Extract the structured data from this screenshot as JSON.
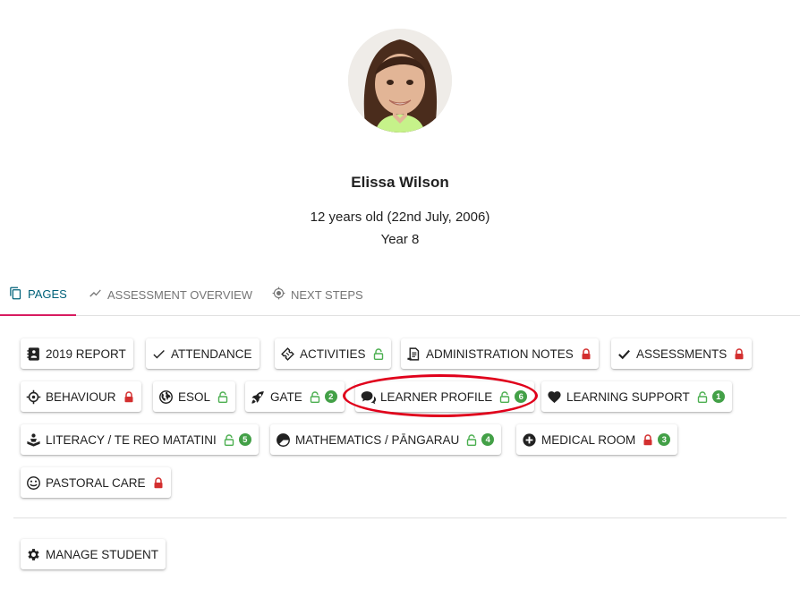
{
  "student": {
    "name": "Elissa Wilson",
    "age_text": "12 years old (22nd July, 2006)",
    "year_text": "Year 8"
  },
  "tabs": [
    {
      "label": "Pages",
      "icon": "copy-pages-icon",
      "active": true
    },
    {
      "label": "Assessment Overview",
      "icon": "trending-line-icon",
      "active": false
    },
    {
      "label": "Next Steps",
      "icon": "crosshair-target-icon",
      "active": false
    }
  ],
  "pages": [
    {
      "label": "2019 Report",
      "icon": "contact-book-icon"
    },
    {
      "label": "Attendance",
      "icon": "check-icon"
    },
    {
      "label": "Activities",
      "icon": "ticket-icon",
      "lock": "unlocked"
    },
    {
      "label": "Administration Notes",
      "icon": "document-edit-icon",
      "lock": "locked"
    },
    {
      "label": "Assessments",
      "icon": "check-bold-icon",
      "lock": "locked"
    },
    {
      "label": "Behaviour",
      "icon": "crosshair-icon",
      "lock": "locked"
    },
    {
      "label": "ESOL",
      "icon": "globe-icon",
      "lock": "unlocked"
    },
    {
      "label": "GATE",
      "icon": "rocket-icon",
      "lock": "unlocked",
      "badge": "2"
    },
    {
      "label": "Learner Profile",
      "icon": "chat-bubbles-icon",
      "lock": "unlocked",
      "badge": "6"
    },
    {
      "label": "Learning Support",
      "icon": "heart-icon",
      "lock": "unlocked",
      "badge": "1"
    },
    {
      "label": "Literacy / Te Reo Matatini",
      "icon": "reader-icon",
      "lock": "unlocked",
      "badge": "5"
    },
    {
      "label": "Mathematics / Pāngarau",
      "icon": "pie-chart-icon",
      "lock": "unlocked",
      "badge": "4"
    },
    {
      "label": "Medical Room",
      "icon": "plus-circle-icon",
      "lock": "locked",
      "badge": "3"
    },
    {
      "label": "Pastoral Care",
      "icon": "smiley-icon",
      "lock": "locked"
    }
  ],
  "manage": {
    "label": "Manage Student",
    "icon": "gear-icon"
  },
  "colors": {
    "active_tab_text": "#00627a",
    "active_tab_underline": "#d81b60",
    "locked": "#d32f2f",
    "unlocked": "#4caf50",
    "badge": "#43a047",
    "highlight_ring": "#e0001b"
  }
}
